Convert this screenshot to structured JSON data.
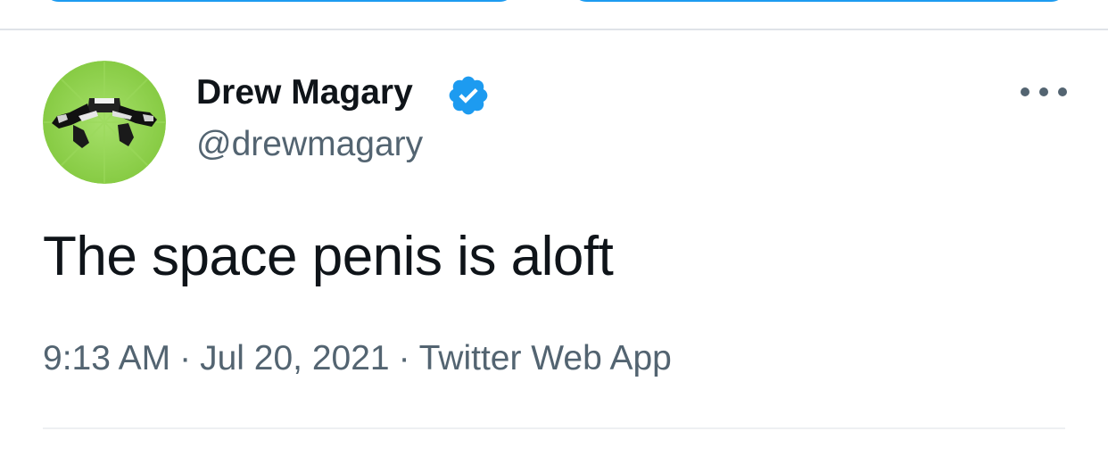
{
  "author": {
    "name": "Drew Magary",
    "handle": "@drewmagary",
    "verified": true,
    "avatar_icon": "avatar-image"
  },
  "tweet": {
    "text": "The space penis is aloft"
  },
  "meta": {
    "time": "9:13 AM",
    "date": "Jul 20, 2021",
    "source": "Twitter Web App",
    "separator": "·"
  },
  "icons": {
    "verified": "verified-badge-icon",
    "more": "more-options-icon"
  },
  "colors": {
    "accent": "#1d9bf0",
    "text": "#0f1419",
    "secondary": "#536471",
    "avatar_bg": "#8fd14f"
  }
}
